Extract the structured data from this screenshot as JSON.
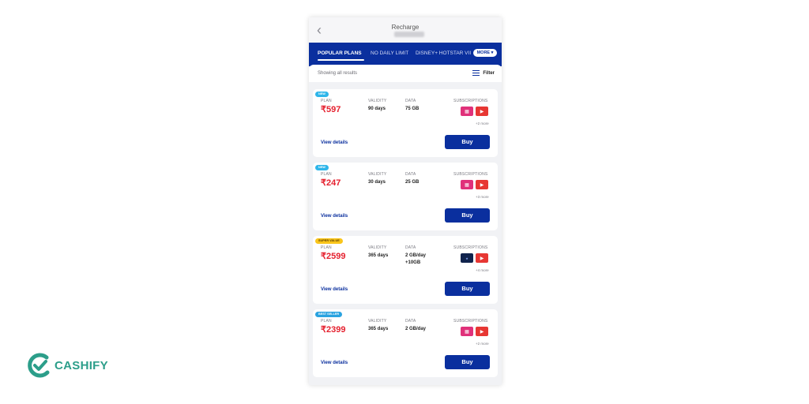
{
  "header": {
    "title": "Recharge"
  },
  "tabs": [
    {
      "label": "POPULAR PLANS",
      "active": true
    },
    {
      "label": "NO DAILY LIMIT",
      "active": false
    },
    {
      "label": "DISNEY+ HOTSTAR VII",
      "active": false
    }
  ],
  "more_label": "MORE",
  "results": {
    "text": "Showing all results",
    "filter_label": "Filter"
  },
  "labels": {
    "plan": "PLAN",
    "validity": "VALIDITY",
    "data": "DATA",
    "subscriptions": "SUBSCRIPTIONS",
    "view_details": "View details",
    "buy": "Buy"
  },
  "plans": [
    {
      "badge": "NEW",
      "badge_color": "#2fb6ea",
      "price": "₹597",
      "validity": "90 days",
      "data": "75 GB",
      "data_extra": "",
      "subs_more": "+2 more"
    },
    {
      "badge": "NEW",
      "badge_color": "#2fb6ea",
      "price": "₹247",
      "validity": "30 days",
      "data": "25 GB",
      "data_extra": "",
      "subs_more": "+3 more"
    },
    {
      "badge": "SUPER VALUE",
      "badge_color": "#f9c51b",
      "price": "₹2599",
      "validity": "365 days",
      "data": "2 GB/day",
      "data_extra": "+10GB",
      "subs_more": "+4 more"
    },
    {
      "badge": "BEST SELLER",
      "badge_color": "#2aa3e0",
      "price": "₹2399",
      "validity": "365 days",
      "data": "2 GB/day",
      "data_extra": "",
      "subs_more": "+2 more"
    }
  ],
  "brand": {
    "name": "CASHIFY",
    "color": "#2c9e8a",
    "accent": "#0a2f9e",
    "price_color": "#e5202e"
  }
}
